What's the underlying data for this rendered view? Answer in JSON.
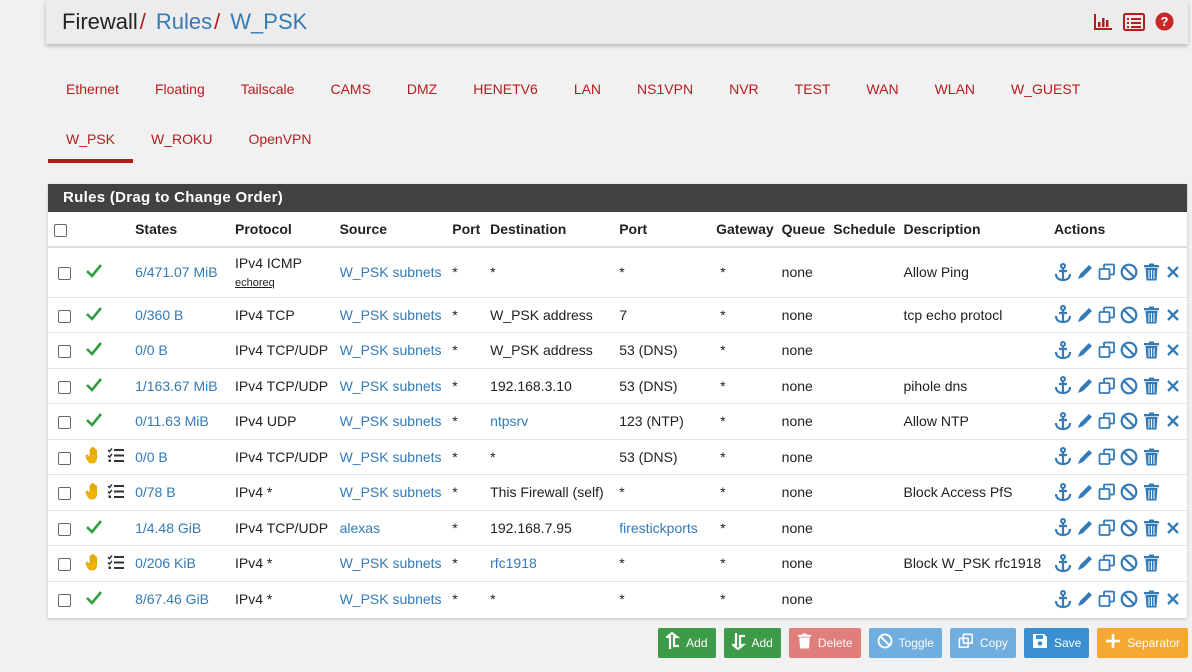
{
  "breadcrumb": {
    "root": "Firewall",
    "sep": "/",
    "item1": "Rules",
    "item2": "W_PSK"
  },
  "header_icons": [
    "chart-bar-icon",
    "list-icon",
    "help-icon"
  ],
  "tabs_row1": [
    "Ethernet",
    "Floating",
    "Tailscale",
    "CAMS",
    "DMZ",
    "HENETV6",
    "LAN",
    "NS1VPN",
    "NVR",
    "TEST",
    "WAN",
    "WLAN",
    "W_GUEST"
  ],
  "tabs_row2": [
    "W_PSK",
    "W_ROKU",
    "OpenVPN"
  ],
  "active_tab": "W_PSK",
  "panel": {
    "title": "Rules (Drag to Change Order)"
  },
  "columns": [
    "States",
    "Protocol",
    "Source",
    "Port",
    "Destination",
    "Port",
    "Gateway",
    "Queue",
    "Schedule",
    "Description",
    "Actions"
  ],
  "rules": [
    {
      "status": "pass",
      "states": "6/471.07 MiB",
      "protocol": "IPv4 ICMP",
      "protocol_sub": "echoreq",
      "source": "W_PSK subnets",
      "src_port": "*",
      "destination": "*",
      "dest_link": false,
      "dst_port": "*",
      "dst_port_link": false,
      "gateway": "*",
      "queue": "none",
      "schedule": "",
      "description": "Allow Ping",
      "has_delete_x": true
    },
    {
      "status": "pass",
      "states": "0/360 B",
      "protocol": "IPv4 TCP",
      "protocol_sub": "",
      "source": "W_PSK subnets",
      "src_port": "*",
      "destination": "W_PSK address",
      "dest_link": false,
      "dst_port": "7",
      "dst_port_link": false,
      "gateway": "*",
      "queue": "none",
      "schedule": "",
      "description": "tcp echo protocl",
      "has_delete_x": true
    },
    {
      "status": "pass",
      "states": "0/0 B",
      "protocol": "IPv4 TCP/UDP",
      "protocol_sub": "",
      "source": "W_PSK subnets",
      "src_port": "*",
      "destination": "W_PSK address",
      "dest_link": false,
      "dst_port": "53 (DNS)",
      "dst_port_link": false,
      "gateway": "*",
      "queue": "none",
      "schedule": "",
      "description": "",
      "has_delete_x": true
    },
    {
      "status": "pass",
      "states": "1/163.67 MiB",
      "protocol": "IPv4 TCP/UDP",
      "protocol_sub": "",
      "source": "W_PSK subnets",
      "src_port": "*",
      "destination": "192.168.3.10",
      "dest_link": false,
      "dst_port": "53 (DNS)",
      "dst_port_link": false,
      "gateway": "*",
      "queue": "none",
      "schedule": "",
      "description": "pihole dns",
      "has_delete_x": true
    },
    {
      "status": "pass",
      "states": "0/11.63 MiB",
      "protocol": "IPv4 UDP",
      "protocol_sub": "",
      "source": "W_PSK subnets",
      "src_port": "*",
      "destination": "ntpsrv",
      "dest_link": true,
      "dst_port": "123 (NTP)",
      "dst_port_link": false,
      "gateway": "*",
      "queue": "none",
      "schedule": "",
      "description": "Allow NTP",
      "has_delete_x": true
    },
    {
      "status": "block",
      "states": "0/0 B",
      "protocol": "IPv4 TCP/UDP",
      "protocol_sub": "",
      "source": "W_PSK subnets",
      "src_port": "*",
      "destination": "*",
      "dest_link": false,
      "dst_port": "53 (DNS)",
      "dst_port_link": false,
      "gateway": "*",
      "queue": "none",
      "schedule": "",
      "description": "",
      "has_delete_x": false
    },
    {
      "status": "block",
      "states": "0/78 B",
      "protocol": "IPv4 *",
      "protocol_sub": "",
      "source": "W_PSK subnets",
      "src_port": "*",
      "destination": "This Firewall (self)",
      "dest_link": false,
      "dst_port": "*",
      "dst_port_link": false,
      "gateway": "*",
      "queue": "none",
      "schedule": "",
      "description": "Block Access PfS",
      "has_delete_x": false
    },
    {
      "status": "pass",
      "states": "1/4.48 GiB",
      "protocol": "IPv4 TCP/UDP",
      "protocol_sub": "",
      "source": "alexas",
      "src_port": "*",
      "destination": "192.168.7.95",
      "dest_link": false,
      "dst_port": "firestickports",
      "dst_port_link": true,
      "gateway": "*",
      "queue": "none",
      "schedule": "",
      "description": "",
      "has_delete_x": true
    },
    {
      "status": "block",
      "states": "0/206 KiB",
      "protocol": "IPv4 *",
      "protocol_sub": "",
      "source": "W_PSK subnets",
      "src_port": "*",
      "destination": "rfc1918",
      "dest_link": true,
      "dst_port": "*",
      "dst_port_link": false,
      "gateway": "*",
      "queue": "none",
      "schedule": "",
      "description": "Block W_PSK rfc1918",
      "has_delete_x": false
    },
    {
      "status": "pass",
      "states": "8/67.46 GiB",
      "protocol": "IPv4 *",
      "protocol_sub": "",
      "source": "W_PSK subnets",
      "src_port": "*",
      "destination": "*",
      "dest_link": false,
      "dst_port": "*",
      "dst_port_link": false,
      "gateway": "*",
      "queue": "none",
      "schedule": "",
      "description": "",
      "has_delete_x": true
    }
  ],
  "buttons": [
    {
      "label": "Add",
      "icon": "arrow-up-add-icon",
      "color": "#3c9a48"
    },
    {
      "label": "Add",
      "icon": "arrow-down-add-icon",
      "color": "#3c9a48"
    },
    {
      "label": "Delete",
      "icon": "trash-icon",
      "color": "#d9534f"
    },
    {
      "label": "Toggle",
      "icon": "ban-icon",
      "color": "#5aa3dc"
    },
    {
      "label": "Copy",
      "icon": "copy-icon",
      "color": "#5aa3dc"
    },
    {
      "label": "Save",
      "icon": "save-icon",
      "color": "#3a8fd1"
    },
    {
      "label": "Separator",
      "icon": "plus-icon",
      "color": "#f6a930"
    }
  ],
  "colors": {
    "accent": "#b71c1c",
    "link": "#337ab7",
    "pass": "#2e9e3e",
    "block": "#f0b400",
    "panel_header": "#424242"
  }
}
